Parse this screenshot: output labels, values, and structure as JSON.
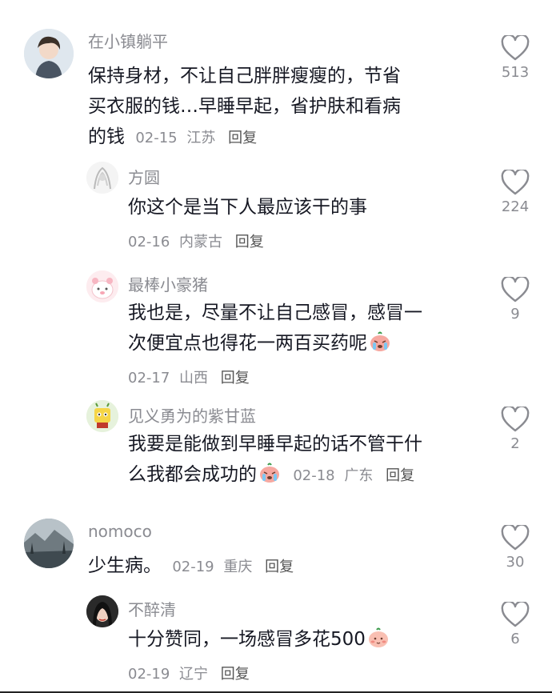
{
  "comments": [
    {
      "username": "在小镇躺平",
      "lines": [
        "保持身材，不让自己胖胖瘦瘦的，节省",
        "买衣服的钱…早睡早起，省护肤和看病",
        "的钱"
      ],
      "date": "02-15",
      "location": "江苏",
      "reply_label": "回复",
      "likes": "513"
    },
    {
      "username": "方圆",
      "lines": [
        "你这个是当下人最应该干的事"
      ],
      "date": "02-16",
      "location": "内蒙古",
      "reply_label": "回复",
      "likes": "224"
    },
    {
      "username": "最棒小豪猪",
      "lines": [
        "我也是，尽量不让自己感冒，感冒一",
        "次便宜点也得花一两百买药呢"
      ],
      "date": "02-17",
      "location": "山西",
      "reply_label": "回复",
      "likes": "9"
    },
    {
      "username": "见义勇为的紫甘蓝",
      "lines": [
        "我要是能做到早睡早起的话不管干什",
        "么我都会成功的"
      ],
      "date": "02-18",
      "location": "广东",
      "reply_label": "回复",
      "likes": "2"
    },
    {
      "username": "nomoco",
      "lines": [
        "少生病。"
      ],
      "date": "02-19",
      "location": "重庆",
      "reply_label": "回复",
      "likes": "30"
    },
    {
      "username": "不醉清",
      "lines": [
        "十分赞同，一场感冒多花500"
      ],
      "date": "02-19",
      "location": "辽宁",
      "reply_label": "回复",
      "likes": "6"
    }
  ],
  "icons": {
    "like": "heart-outline-icon",
    "emoji_cry": "crying-face-emoji",
    "emoji_blush": "blushing-face-emoji"
  },
  "colors": {
    "text": "#161823",
    "secondary": "#8a8b91",
    "background": "#ffffff"
  }
}
